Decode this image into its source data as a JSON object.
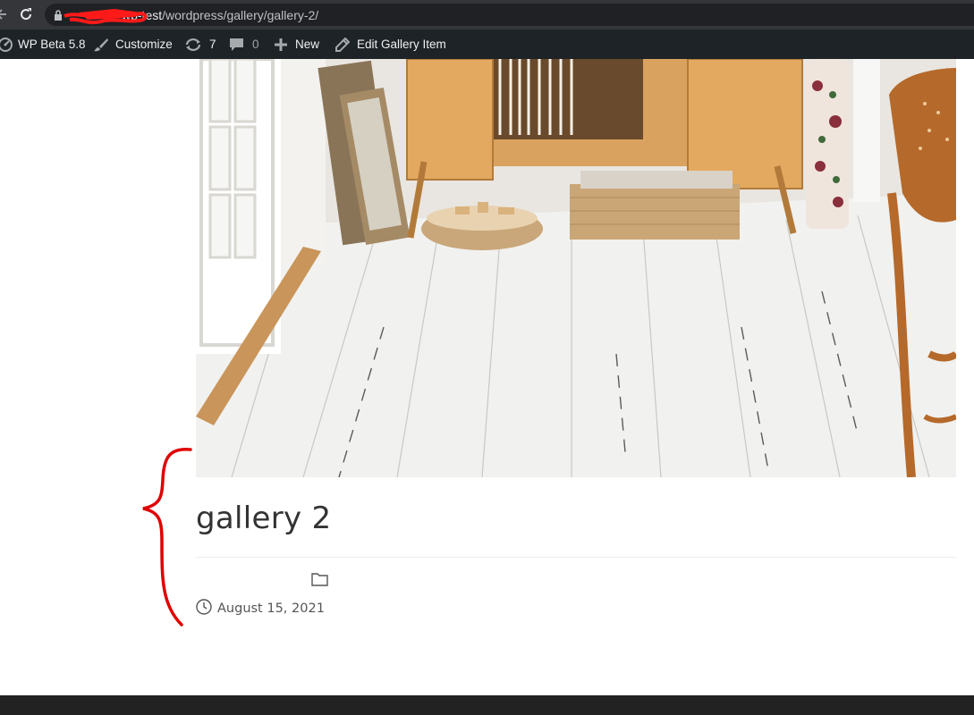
{
  "browser": {
    "url_host": "wp-test",
    "url_path": "/wordpress/gallery/gallery-2/"
  },
  "admin_bar": {
    "site_name": "WP Beta 5.8",
    "customize_label": "Customize",
    "updates_count": "7",
    "comments_count": "0",
    "new_label": "New",
    "edit_label": "Edit Gallery Item"
  },
  "post": {
    "title": "gallery 2",
    "date": "August 15, 2021"
  },
  "colors": {
    "admin_bar_bg": "#1d2327",
    "browser_bar_bg": "#35363a",
    "annotation": "#e00000",
    "footer_bg": "#222222"
  }
}
